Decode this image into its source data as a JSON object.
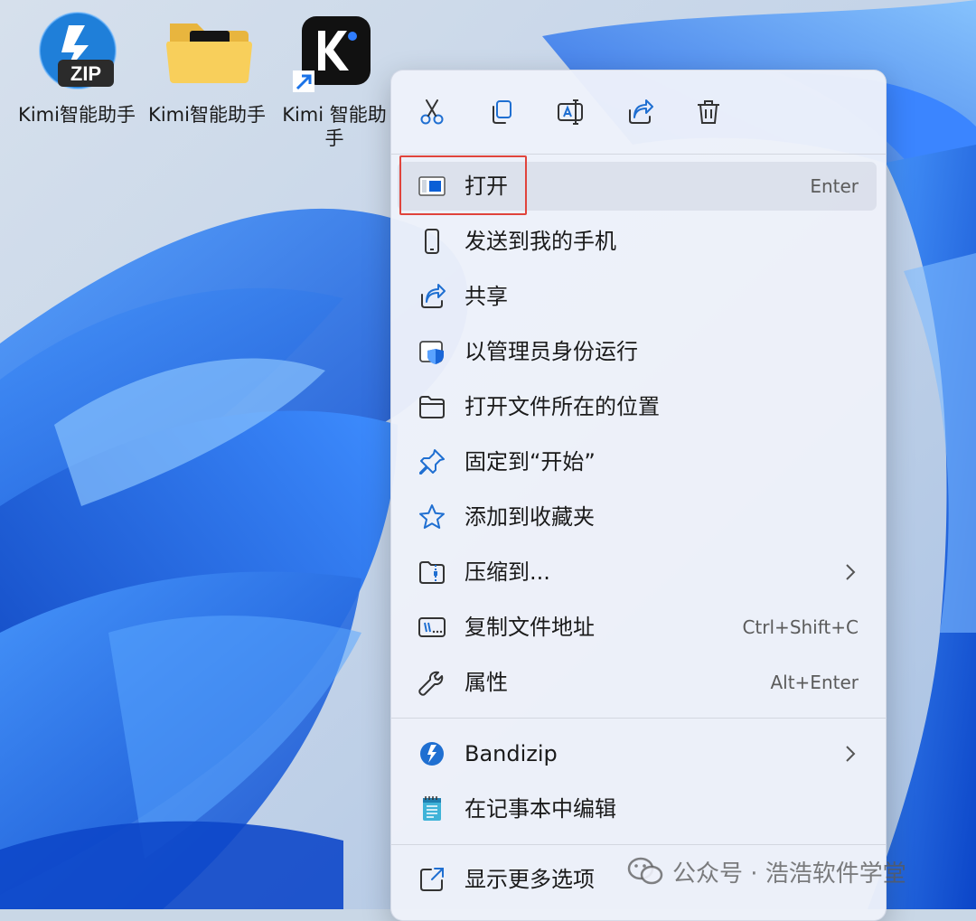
{
  "desktop": {
    "icons": [
      {
        "label": "Kimi智能助手",
        "type": "zip-archive"
      },
      {
        "label": "Kimi智能助手",
        "type": "folder"
      },
      {
        "label": "Kimi 智能助手",
        "type": "app-shortcut"
      }
    ],
    "zip_badge_text": "ZIP"
  },
  "context_menu": {
    "toolbar": [
      {
        "name": "cut",
        "icon": "scissors-icon"
      },
      {
        "name": "copy",
        "icon": "copy-icon"
      },
      {
        "name": "rename",
        "icon": "rename-icon"
      },
      {
        "name": "share",
        "icon": "share-icon"
      },
      {
        "name": "delete",
        "icon": "trash-icon"
      }
    ],
    "items": [
      {
        "label": "打开",
        "shortcut": "Enter",
        "icon": "open-window-icon"
      },
      {
        "label": "发送到我的手机",
        "shortcut": "",
        "icon": "phone-icon"
      },
      {
        "label": "共享",
        "shortcut": "",
        "icon": "share-icon"
      },
      {
        "label": "以管理员身份运行",
        "shortcut": "",
        "icon": "admin-shield-icon"
      },
      {
        "label": "打开文件所在的位置",
        "shortcut": "",
        "icon": "folder-icon"
      },
      {
        "label": "固定到“开始”",
        "shortcut": "",
        "icon": "pin-icon"
      },
      {
        "label": "添加到收藏夹",
        "shortcut": "",
        "icon": "star-icon"
      },
      {
        "label": "压缩到...",
        "shortcut": "",
        "icon": "zip-folder-icon",
        "submenu": true
      },
      {
        "label": "复制文件地址",
        "shortcut": "Ctrl+Shift+C",
        "icon": "copy-path-icon"
      },
      {
        "label": "属性",
        "shortcut": "Alt+Enter",
        "icon": "wrench-icon"
      },
      {
        "label": "Bandizip",
        "shortcut": "",
        "icon": "bandizip-icon",
        "submenu": true
      },
      {
        "label": "在记事本中编辑",
        "shortcut": "",
        "icon": "notepad-icon"
      },
      {
        "label": "显示更多选项",
        "shortcut": "",
        "icon": "more-options-icon"
      }
    ]
  },
  "watermark": {
    "text": "公众号 · 浩浩软件学堂"
  },
  "colors": {
    "accent": "#0067c0",
    "highlight_border": "#e0443c",
    "menu_background": "#eef1fa",
    "wallpaper_blue": "#1f6cf0"
  }
}
